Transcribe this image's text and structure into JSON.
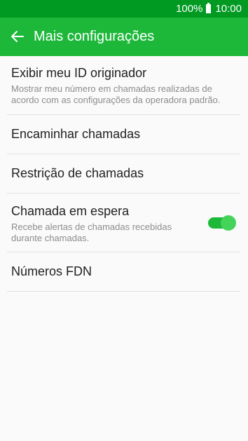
{
  "status_bar": {
    "battery": "100%",
    "time": "10:00"
  },
  "app_bar": {
    "title": "Mais configurações",
    "back_icon": "arrow-left-icon"
  },
  "settings": {
    "items": [
      {
        "label": "Exibir meu ID originador",
        "description": "Mostrar meu número em chamadas realizadas de acordo com as configurações da operadora padrão."
      },
      {
        "label": "Encaminhar chamadas"
      },
      {
        "label": "Restrição de chamadas"
      },
      {
        "label": "Chamada em espera",
        "description": "Recebe alertas de chamadas recebidas durante chamadas.",
        "toggle_on": true
      },
      {
        "label": "Números FDN"
      }
    ]
  },
  "colors": {
    "status_bar": "#009a22",
    "app_bar": "#1db83a",
    "toggle_on": "#44d45a"
  }
}
